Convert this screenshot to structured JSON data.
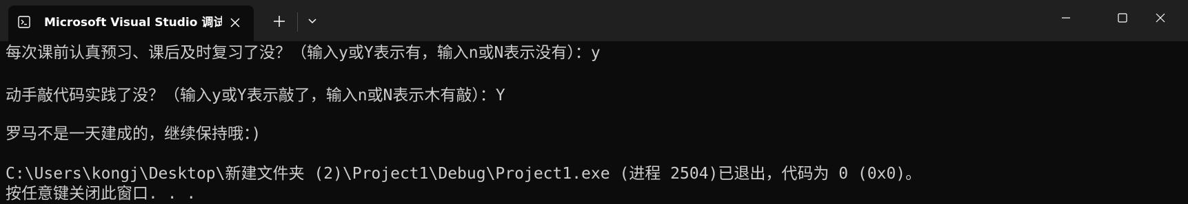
{
  "window": {
    "tab_title": "Microsoft Visual Studio 调试控制台",
    "tab_icon": "console-icon",
    "close_tab_icon": "close-icon",
    "new_tab_icon": "plus-icon",
    "dropdown_icon": "chevron-down-icon",
    "controls": [
      "minimize-icon",
      "maximize-icon",
      "close-icon"
    ]
  },
  "console": {
    "lines": [
      "每次课前认真预习、课后及时复习了没？（输入y或Y表示有，输入n或N表示没有）：y",
      "动手敲代码实践了没？（输入y或Y表示敲了，输入n或N表示木有敲）：Y",
      "罗马不是一天建成的，继续保持哦：)",
      "C:\\Users\\kongj\\Desktop\\新建文件夹 (2)\\Project1\\Debug\\Project1.exe (进程 2504)已退出，代码为 0 (0x0)。",
      "按任意键关闭此窗口. . ."
    ],
    "text_color": "#cccccc",
    "background": "#0c0c0c"
  }
}
